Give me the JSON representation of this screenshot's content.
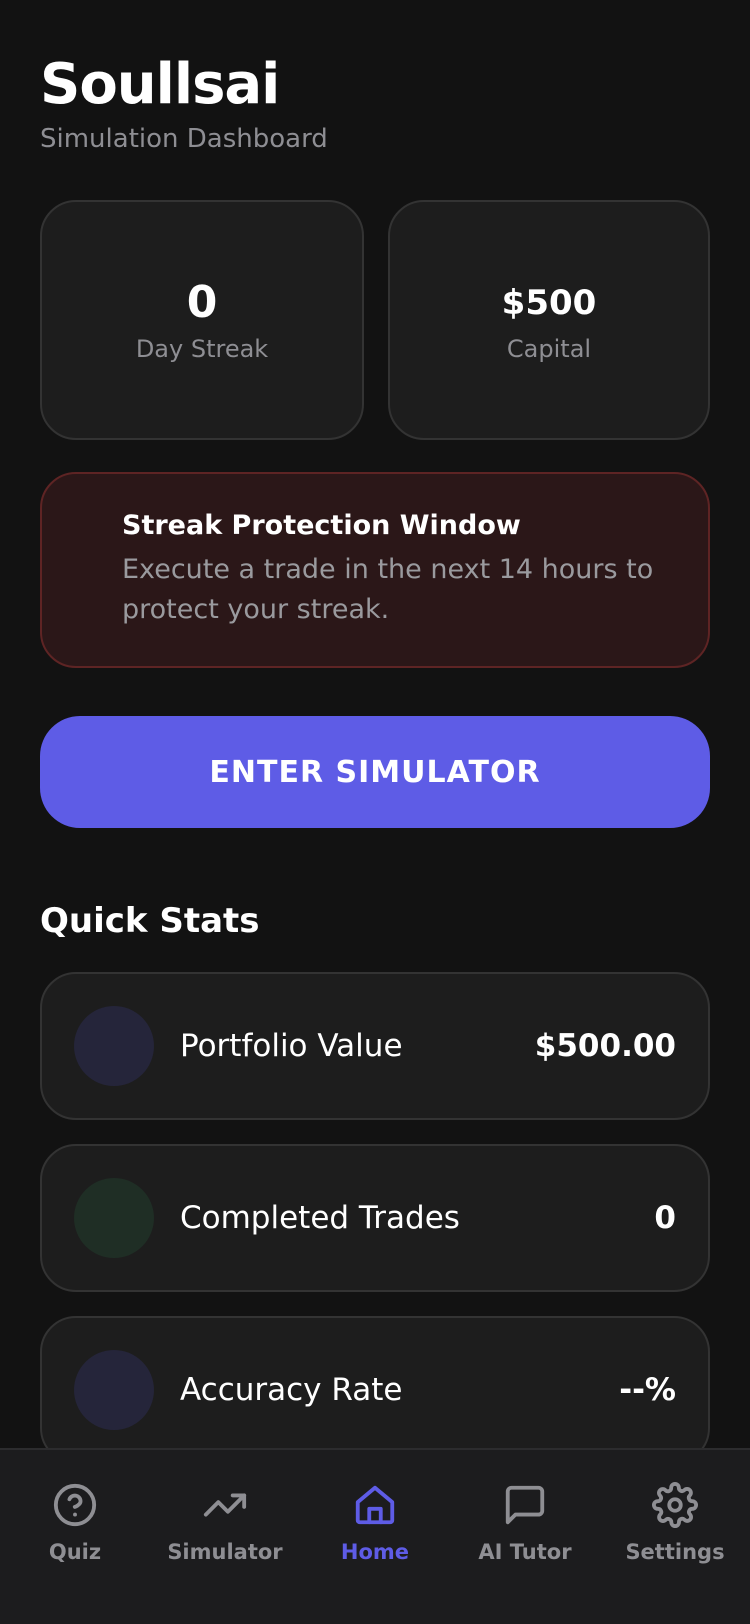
{
  "app": {
    "title": "Soullsai",
    "subtitle": "Simulation Dashboard"
  },
  "stats": {
    "streak_value": "0",
    "streak_label": "Day Streak",
    "capital_value": "$500",
    "capital_label": "Capital"
  },
  "warning": {
    "title": "Streak Protection Window",
    "text": "Execute a trade in the next 14 hours to protect your streak."
  },
  "cta": {
    "label": "ENTER SIMULATOR"
  },
  "quick_stats": {
    "title": "Quick Stats",
    "items": [
      {
        "label": "Portfolio Value",
        "value": "$500.00",
        "icon_color": "#25253a"
      },
      {
        "label": "Completed Trades",
        "value": "0",
        "icon_color": "#1f2e25"
      },
      {
        "label": "Accuracy Rate",
        "value": "--%",
        "icon_color": "#25253a"
      }
    ]
  },
  "tabbar": {
    "items": [
      {
        "label": "Quiz",
        "icon": "help-circle-icon"
      },
      {
        "label": "Simulator",
        "icon": "trending-up-icon"
      },
      {
        "label": "Home",
        "icon": "home-icon",
        "active": true
      },
      {
        "label": "AI Tutor",
        "icon": "chat-bubble-icon"
      },
      {
        "label": "Settings",
        "icon": "gear-icon"
      }
    ]
  },
  "colors": {
    "background": "#121212",
    "accent": "#5e5ce6",
    "card": "#1d1d1d",
    "warning_bg": "#2b1718",
    "warning_border": "#5e2424"
  }
}
